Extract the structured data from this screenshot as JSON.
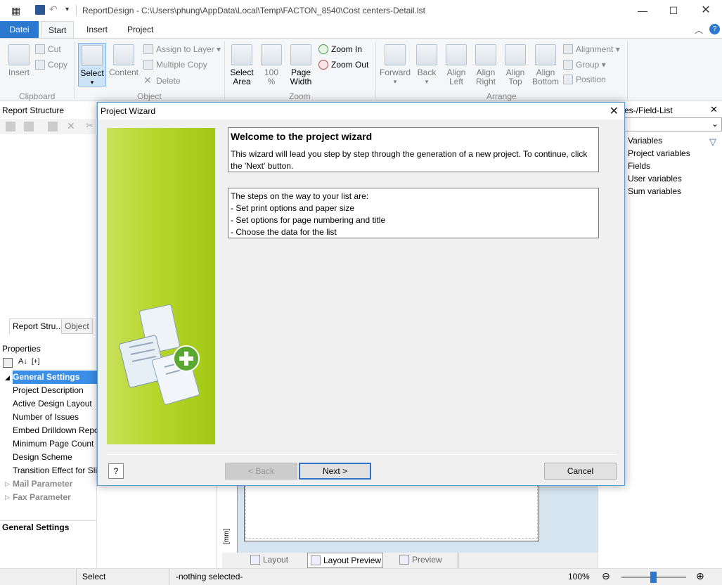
{
  "window": {
    "title": "ReportDesign - C:\\Users\\phung\\AppData\\Local\\Temp\\FACTON_8540\\Cost centers-Detail.lst"
  },
  "ribbon_tabs": [
    "Datei",
    "Start",
    "Insert",
    "Project"
  ],
  "ribbon": {
    "insert": "Insert",
    "cut": "Cut",
    "copy": "Copy",
    "select": "Select",
    "content": "Content",
    "assign_to_layer": "Assign to Layer",
    "multiple_copy": "Multiple Copy",
    "delete": "Delete",
    "select_area": [
      "Select",
      "Area"
    ],
    "percent": [
      "100",
      "%"
    ],
    "page_width": [
      "Page",
      "Width"
    ],
    "zoom_in": "Zoom In",
    "zoom_out": "Zoom Out",
    "forward": "Forward",
    "back": "Back",
    "align_left": [
      "Align",
      "Left"
    ],
    "align_right": [
      "Align",
      "Right"
    ],
    "align_top": [
      "Align",
      "Top"
    ],
    "align_bottom": [
      "Align",
      "Bottom"
    ],
    "alignment": "Alignment",
    "group": "Group",
    "position": "Position",
    "groups": [
      "Clipboard",
      "Object",
      "Zoom",
      "Arrange"
    ]
  },
  "left_panel": {
    "report_structure": "Report Structure",
    "tabs": [
      "Report Stru...",
      "Object"
    ],
    "properties": "Properties",
    "prop_rows": [
      "General Settings",
      "Project Description",
      "Active Design Layout",
      "Number of Issues",
      "Embed Drilldown Repo",
      "Minimum Page Count",
      "Design Scheme",
      "Transition Effect for Sli",
      "Mail Parameter",
      "Fax Parameter"
    ],
    "description_title": "General Settings"
  },
  "right_panel": {
    "title": "es-/Field-List",
    "items": [
      "Variables",
      "Project variables",
      "Fields",
      "User variables",
      "Sum variables"
    ]
  },
  "bottom_tabs": [
    "Layout",
    "Layout Preview",
    "Preview"
  ],
  "ruler_unit": "[mm]",
  "status": {
    "mode": "Select",
    "selection": "-nothing selected-",
    "zoom": "100%"
  },
  "dialog": {
    "title": "Project Wizard",
    "welcome_heading": "Welcome to the project wizard",
    "welcome_text": "This wizard will lead you step by step through the generation of a new project. To continue, click the 'Next' button.",
    "steps": [
      "The steps on the way to your list are:",
      "- Set print options and paper size",
      "- Set options for page numbering and title",
      "- Choose the data for the list"
    ],
    "buttons": {
      "back": "< Back",
      "next": "Next >",
      "cancel": "Cancel"
    }
  }
}
